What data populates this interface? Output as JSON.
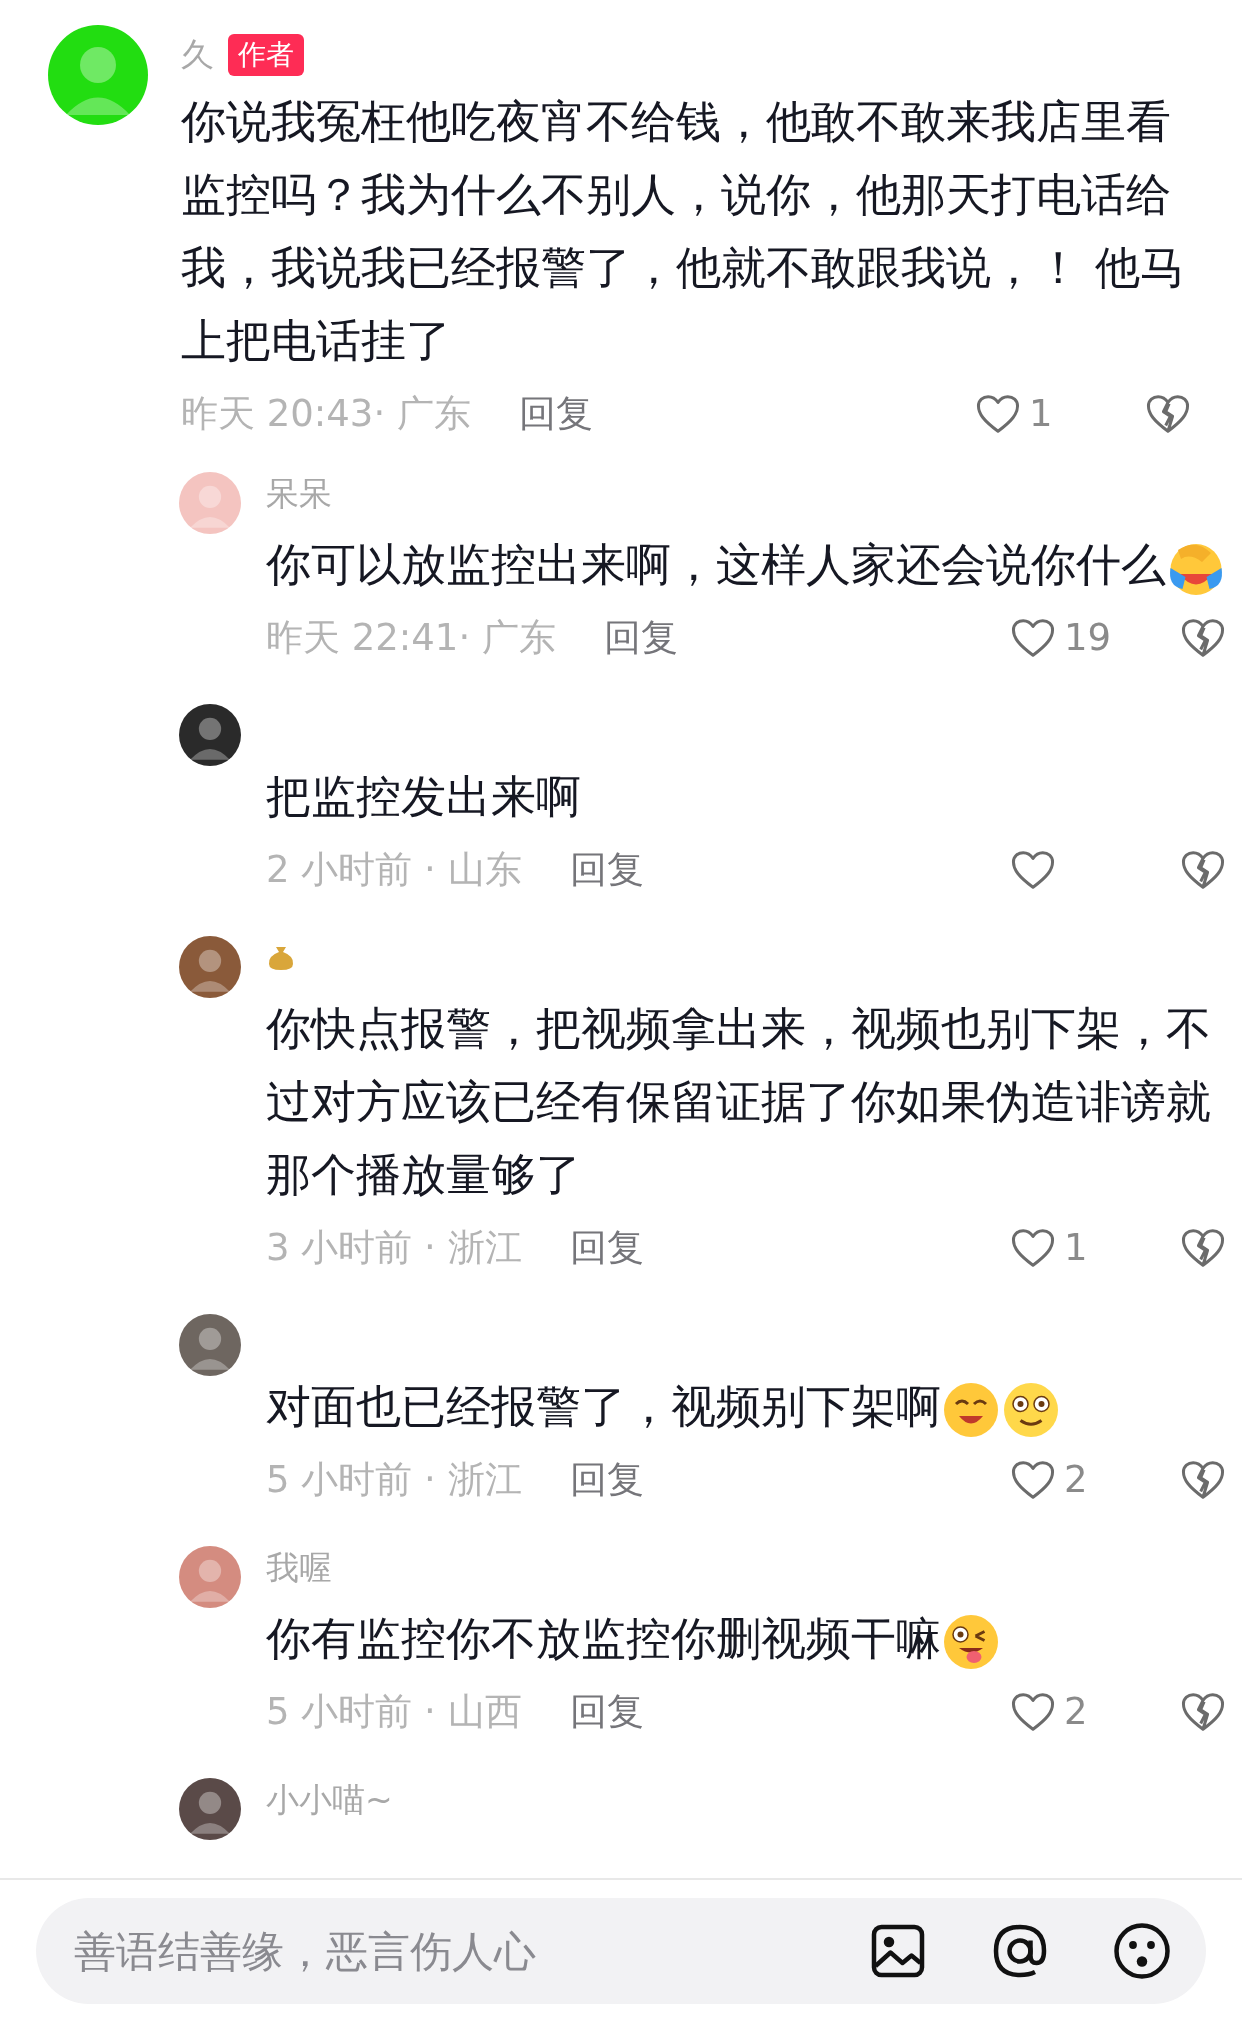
{
  "comments": [
    {
      "kind": "author",
      "name": "久",
      "badge": "作者",
      "color": "#22dd11",
      "text": "你说我冤枉他吃夜宵不给钱，他敢不敢来我店里看监控吗？我为什么不别人，说你，他那天打电话给我，我说我已经报警了，他就不敢跟我说，！ 他马上把电话挂了",
      "time": "昨天 20:43· 广东",
      "reply": "回复",
      "likes": "1"
    },
    {
      "kind": "reply",
      "name": "呆呆",
      "color": "#f4c4c0",
      "text": "你可以放监控出来啊，这样人家还会说你什么",
      "emojis": [
        {
          "kind": "facepalm"
        }
      ],
      "time": "昨天 22:41· 广东",
      "reply": "回复",
      "likes": "19"
    },
    {
      "kind": "reply",
      "color": "#2a2a2a",
      "text": "把监控发出来啊",
      "time": "2 小时前 · 山东",
      "reply": "回复"
    },
    {
      "kind": "reply",
      "name_icon": {
        "kind": "money-bag"
      },
      "color": "#8a5a3a",
      "text": "你快点报警，把视频拿出来，视频也别下架，不过对方应该已经有保留证据了你如果伪造诽谤就那个播放量够了",
      "time": "3 小时前 · 浙江",
      "reply": "回复",
      "likes": "1"
    },
    {
      "kind": "reply",
      "color": "#6e6660",
      "text": "对面也已经报警了，视频别下架啊",
      "emojis": [
        {
          "kind": "smile"
        },
        {
          "kind": "dazed"
        }
      ],
      "time": "5 小时前 · 浙江",
      "reply": "回复",
      "likes": "2"
    },
    {
      "kind": "reply",
      "name": "我喔",
      "color": "#d48c80",
      "text": "你有监控你不放监控你删视频干嘛",
      "emojis": [
        {
          "kind": "wink"
        }
      ],
      "time": "5 小时前 · 山西",
      "reply": "回复",
      "likes": "2"
    },
    {
      "kind": "reply",
      "name": "小小喵~",
      "color": "#5a4a48"
    }
  ],
  "input": {
    "placeholder": "善语结善缘，恶言伤人心"
  }
}
